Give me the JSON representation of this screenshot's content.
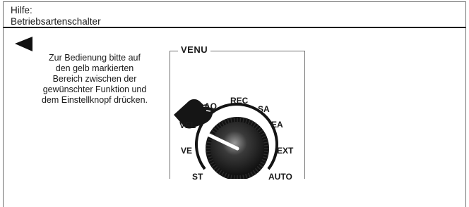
{
  "header": {
    "line1": "Hilfe:",
    "line2": "Betriebsartenschalter"
  },
  "navigation": {
    "back_icon": "triangle-left-icon"
  },
  "instruction": {
    "lines": [
      "Zur Bedienung bitte auf",
      "den gelb markierten",
      "Bereich zwischen der",
      "gewünschter Funktion und",
      "dem Einstellknopf drücken."
    ]
  },
  "selector": {
    "title": "VENU",
    "modes": {
      "st": "ST",
      "ve": "VE",
      "vel": "VEL",
      "aq": "AQ",
      "rec": "REC",
      "sa": "SA",
      "ea": "EA",
      "ext": "EXT",
      "auto": "AUTO"
    },
    "hand_icon": "pointing-hand-icon",
    "knob_icon": "rotary-knob-icon"
  },
  "colors": {
    "border": "#6f6f6f",
    "text": "#1a1a1a",
    "knob_dark": "#141414"
  }
}
